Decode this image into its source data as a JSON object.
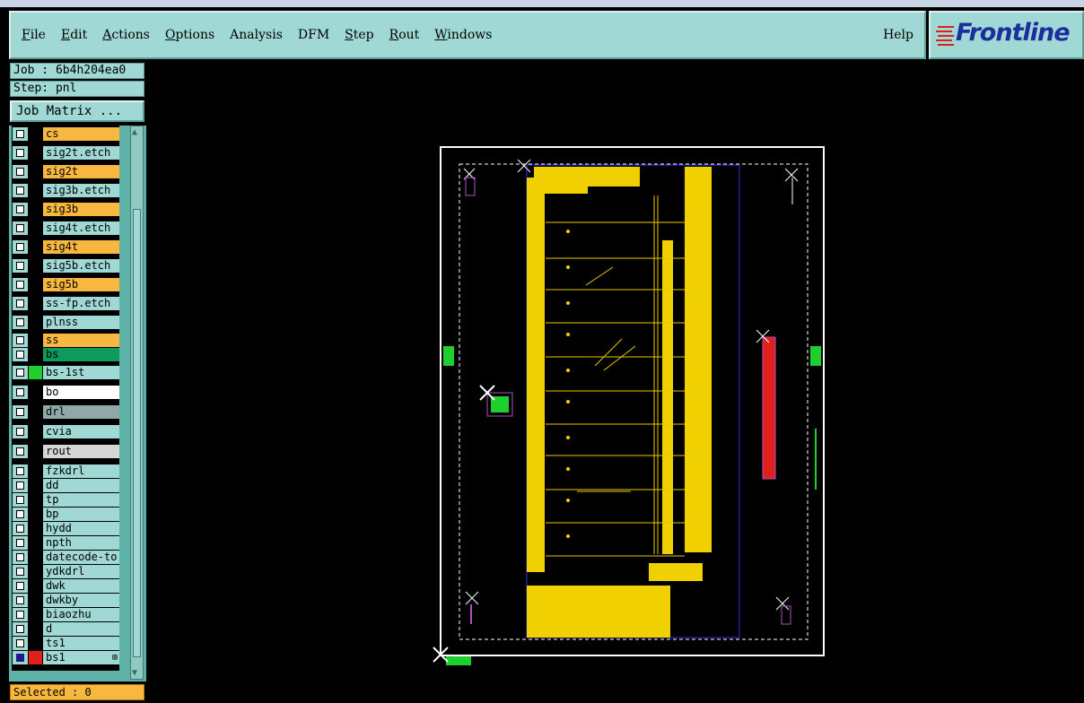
{
  "menubar": {
    "items": [
      "File",
      "Edit",
      "Actions",
      "Options",
      "Analysis",
      "DFM",
      "Step",
      "Rout",
      "Windows"
    ],
    "help": "Help"
  },
  "logo": {
    "text": "Frontline"
  },
  "job": {
    "label": "Job : 6b4h204ea0",
    "step": "Step: pnl",
    "matrix_button": "Job Matrix ..."
  },
  "layers": [
    {
      "name": "cs",
      "bg": "#f8b840",
      "swatch": "#000000",
      "checked": false
    },
    {
      "name": "sig2t.etch",
      "bg": "#9fd8d5",
      "swatch": "#000000",
      "checked": false
    },
    {
      "name": "sig2t",
      "bg": "#f8b840",
      "swatch": "#000000",
      "checked": false
    },
    {
      "name": "sig3b.etch",
      "bg": "#9fd8d5",
      "swatch": "#000000",
      "checked": false
    },
    {
      "name": "sig3b",
      "bg": "#f8b840",
      "swatch": "#000000",
      "checked": false
    },
    {
      "name": "sig4t.etch",
      "bg": "#9fd8d5",
      "swatch": "#000000",
      "checked": false
    },
    {
      "name": "sig4t",
      "bg": "#f8b840",
      "swatch": "#000000",
      "checked": false
    },
    {
      "name": "sig5b.etch",
      "bg": "#9fd8d5",
      "swatch": "#000000",
      "checked": false
    },
    {
      "name": "sig5b",
      "bg": "#f8b840",
      "swatch": "#000000",
      "checked": false
    },
    {
      "name": "ss-fp.etch",
      "bg": "#9fd8d5",
      "swatch": "#000000",
      "checked": false
    },
    {
      "name": "plnss",
      "bg": "#9fd8d5",
      "swatch": "#000000",
      "checked": false
    },
    {
      "name": "ss",
      "bg": "#f8b840",
      "swatch": "#000000",
      "checked": false
    },
    {
      "name": "bs",
      "bg": "#0e9a5a",
      "swatch": "#000000",
      "checked": false
    },
    {
      "name": "bs-1st",
      "bg": "#9fd8d5",
      "swatch": "#1fcf2e",
      "checked": false
    },
    {
      "name": "bo",
      "bg": "#ffffff",
      "swatch": "#000000",
      "checked": false
    },
    {
      "name": "drl",
      "bg": "#8fa8a8",
      "swatch": "#000000",
      "checked": false
    },
    {
      "name": "cvia",
      "bg": "#9fd8d5",
      "swatch": "#000000",
      "checked": false
    },
    {
      "name": "rout",
      "bg": "#d6d6d6",
      "swatch": "#000000",
      "checked": false
    },
    {
      "name": "fzkdrl",
      "bg": "#9fd8d5",
      "swatch": "#000000",
      "checked": false
    },
    {
      "name": "dd",
      "bg": "#9fd8d5",
      "swatch": "#000000",
      "checked": false
    },
    {
      "name": "tp",
      "bg": "#9fd8d5",
      "swatch": "#000000",
      "checked": false
    },
    {
      "name": "bp",
      "bg": "#9fd8d5",
      "swatch": "#000000",
      "checked": false
    },
    {
      "name": "hydd",
      "bg": "#9fd8d5",
      "swatch": "#000000",
      "checked": false
    },
    {
      "name": "npth",
      "bg": "#9fd8d5",
      "swatch": "#000000",
      "checked": false
    },
    {
      "name": "datecode-to",
      "bg": "#9fd8d5",
      "swatch": "#000000",
      "checked": false
    },
    {
      "name": "ydkdrl",
      "bg": "#9fd8d5",
      "swatch": "#000000",
      "checked": false
    },
    {
      "name": "dwk",
      "bg": "#9fd8d5",
      "swatch": "#000000",
      "checked": false
    },
    {
      "name": "dwkby",
      "bg": "#9fd8d5",
      "swatch": "#000000",
      "checked": false
    },
    {
      "name": "biaozhu",
      "bg": "#9fd8d5",
      "swatch": "#000000",
      "checked": false
    },
    {
      "name": "d",
      "bg": "#9fd8d5",
      "swatch": "#000000",
      "checked": false
    },
    {
      "name": "ts1",
      "bg": "#9fd8d5",
      "swatch": "#000000",
      "checked": false
    },
    {
      "name": "bs1",
      "bg": "#9fd8d5",
      "swatch": "#e0201a",
      "checked": true
    }
  ],
  "status": {
    "selected": "Selected : 0"
  },
  "colors": {
    "panel_bg": "#9fd8d5",
    "signal_layer": "#f8d000",
    "copper_trace": "#e8c800",
    "highlight_red": "#e0201a",
    "outline": "#ffffff",
    "marker_green": "#1fcf2e"
  }
}
